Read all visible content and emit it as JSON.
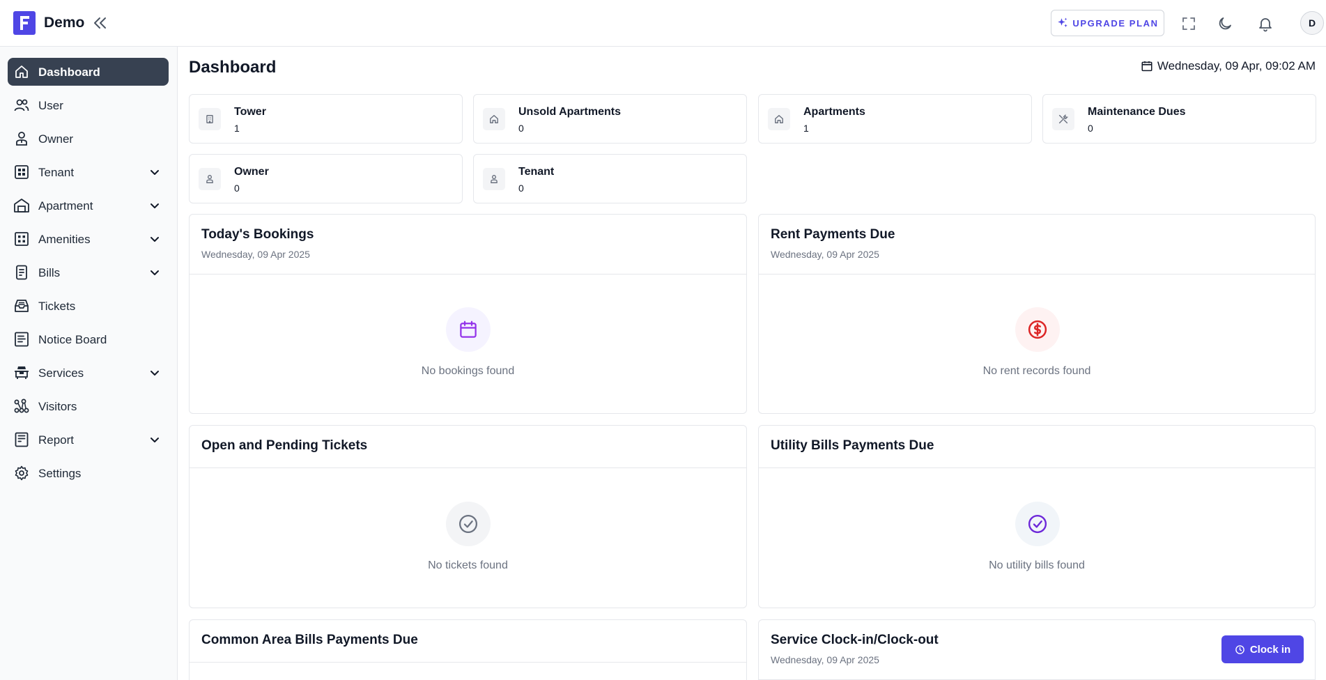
{
  "app": {
    "name": "Demo"
  },
  "header": {
    "upgrade_label": "UPGRADE PLAN",
    "user_initial": "D"
  },
  "sidebar": {
    "items": [
      {
        "label": "Dashboard",
        "icon": "home-icon",
        "active": true
      },
      {
        "label": "User",
        "icon": "users-icon"
      },
      {
        "label": "Owner",
        "icon": "owner-icon"
      },
      {
        "label": "Tenant",
        "icon": "tenant-icon",
        "expandable": true
      },
      {
        "label": "Apartment",
        "icon": "building-icon",
        "expandable": true
      },
      {
        "label": "Amenities",
        "icon": "amenities-icon",
        "expandable": true
      },
      {
        "label": "Bills",
        "icon": "bill-icon",
        "expandable": true
      },
      {
        "label": "Tickets",
        "icon": "ticket-icon"
      },
      {
        "label": "Notice Board",
        "icon": "notice-board-icon"
      },
      {
        "label": "Services",
        "icon": "services-icon",
        "expandable": true
      },
      {
        "label": "Visitors",
        "icon": "visitors-icon"
      },
      {
        "label": "Report",
        "icon": "report-icon",
        "expandable": true
      },
      {
        "label": "Settings",
        "icon": "settings-icon"
      }
    ]
  },
  "main": {
    "title": "Dashboard",
    "datetime": "Wednesday, 09 Apr, 09:02 AM",
    "stats": [
      {
        "label": "Tower",
        "value": "1",
        "icon": "tower-icon"
      },
      {
        "label": "Unsold Apartments",
        "value": "0",
        "icon": "home-icon"
      },
      {
        "label": "Apartments",
        "value": "1",
        "icon": "home-icon"
      },
      {
        "label": "Maintenance Dues",
        "value": "0",
        "icon": "tools-icon"
      },
      {
        "label": "Owner",
        "value": "0",
        "icon": "person-icon"
      },
      {
        "label": "Tenant",
        "value": "0",
        "icon": "person-icon"
      }
    ],
    "panels": {
      "bookings": {
        "title": "Today's Bookings",
        "subtitle": "Wednesday, 09 Apr 2025",
        "empty": "No bookings found",
        "icon": "calendar-icon",
        "accent": "#9333ea"
      },
      "rent": {
        "title": "Rent Payments Due",
        "subtitle": "Wednesday, 09 Apr 2025",
        "empty": "No rent records found",
        "icon": "dollar-icon",
        "accent": "#dc2626"
      },
      "tickets": {
        "title": "Open and Pending Tickets",
        "empty": "No tickets found",
        "icon": "check-circle-icon",
        "accent": "#6b7280"
      },
      "utility": {
        "title": "Utility Bills Payments Due",
        "empty": "No utility bills found",
        "icon": "check-circle-icon",
        "accent": "#6d28d9"
      },
      "common": {
        "title": "Common Area Bills Payments Due"
      },
      "clock": {
        "title": "Service Clock-in/Clock-out",
        "subtitle": "Wednesday, 09 Apr 2025",
        "button": "Clock in"
      }
    }
  },
  "colors": {
    "brand": "#4f46e5",
    "active_nav": "#374151"
  }
}
